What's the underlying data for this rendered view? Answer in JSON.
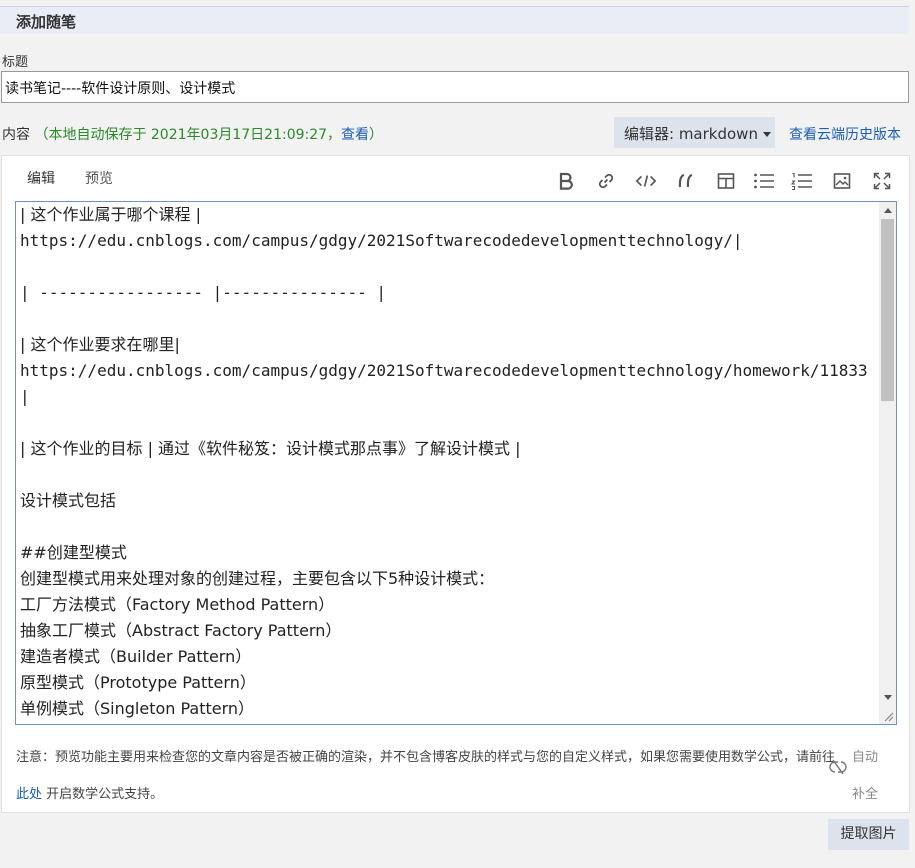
{
  "header": {
    "title": "添加随笔"
  },
  "title_field": {
    "label": "标题",
    "value": "读书笔记----软件设计原则、设计模式"
  },
  "content": {
    "label": "内容",
    "autosave_text": "（本地自动保存于 2021年03月17日21:09:27，",
    "autosave_link": "查看",
    "autosave_close": "）"
  },
  "editor_select": {
    "label": "编辑器: markdown"
  },
  "history_link": "查看云端历史版本",
  "tabs": [
    {
      "label": "编辑"
    },
    {
      "label": "预览"
    }
  ],
  "toolbar": [
    {
      "icon": "bold-icon",
      "glyph": "B"
    },
    {
      "icon": "link-icon",
      "glyph": ""
    },
    {
      "icon": "code-icon",
      "glyph": ""
    },
    {
      "icon": "quote-icon",
      "glyph": ""
    },
    {
      "icon": "table-icon",
      "glyph": ""
    },
    {
      "icon": "bullet-list-icon",
      "glyph": ""
    },
    {
      "icon": "numbered-list-icon",
      "glyph": ""
    },
    {
      "icon": "image-icon",
      "glyph": ""
    },
    {
      "icon": "fullscreen-icon",
      "glyph": ""
    }
  ],
  "editor_lines": [
    "| 这个作业属于哪个课程 |",
    "https://edu.cnblogs.com/campus/gdgy/2021Softwarecodedevelopmenttechnology/|",
    "",
    "| ----------------- |--------------- |",
    "",
    "| 这个作业要求在哪里|",
    "https://edu.cnblogs.com/campus/gdgy/2021Softwarecodedevelopmenttechnology/homework/11833",
    "|",
    "",
    "| 这个作业的目标 | 通过《软件秘笈：设计模式那点事》了解设计模式 |",
    "",
    "设计模式包括",
    "",
    "##创建型模式",
    "创建型模式用来处理对象的创建过程，主要包含以下5种设计模式：",
    "工厂方法模式（Factory Method Pattern）",
    "抽象工厂模式（Abstract Factory Pattern）",
    "建造者模式（Builder Pattern）",
    "原型模式（Prototype Pattern）",
    "单例模式（Singleton Pattern）"
  ],
  "note": {
    "text_before": "注意：预览功能主要用来检查您的文章内容是否被正确的渲染，并不包含博客皮肤的样式与您的自定义样式，如果您需要使用数学公式，请前往 ",
    "link": "此处",
    "text_after": " 开启数学公式支持。"
  },
  "autocomplete": {
    "line1": "自动",
    "line2": "补全"
  },
  "extract_button": "提取图片",
  "colors": {
    "link": "#1a5fb4",
    "autosave": "#2a8a2a",
    "header_bg": "#e8edf6",
    "button_bg": "#dde3ec"
  }
}
